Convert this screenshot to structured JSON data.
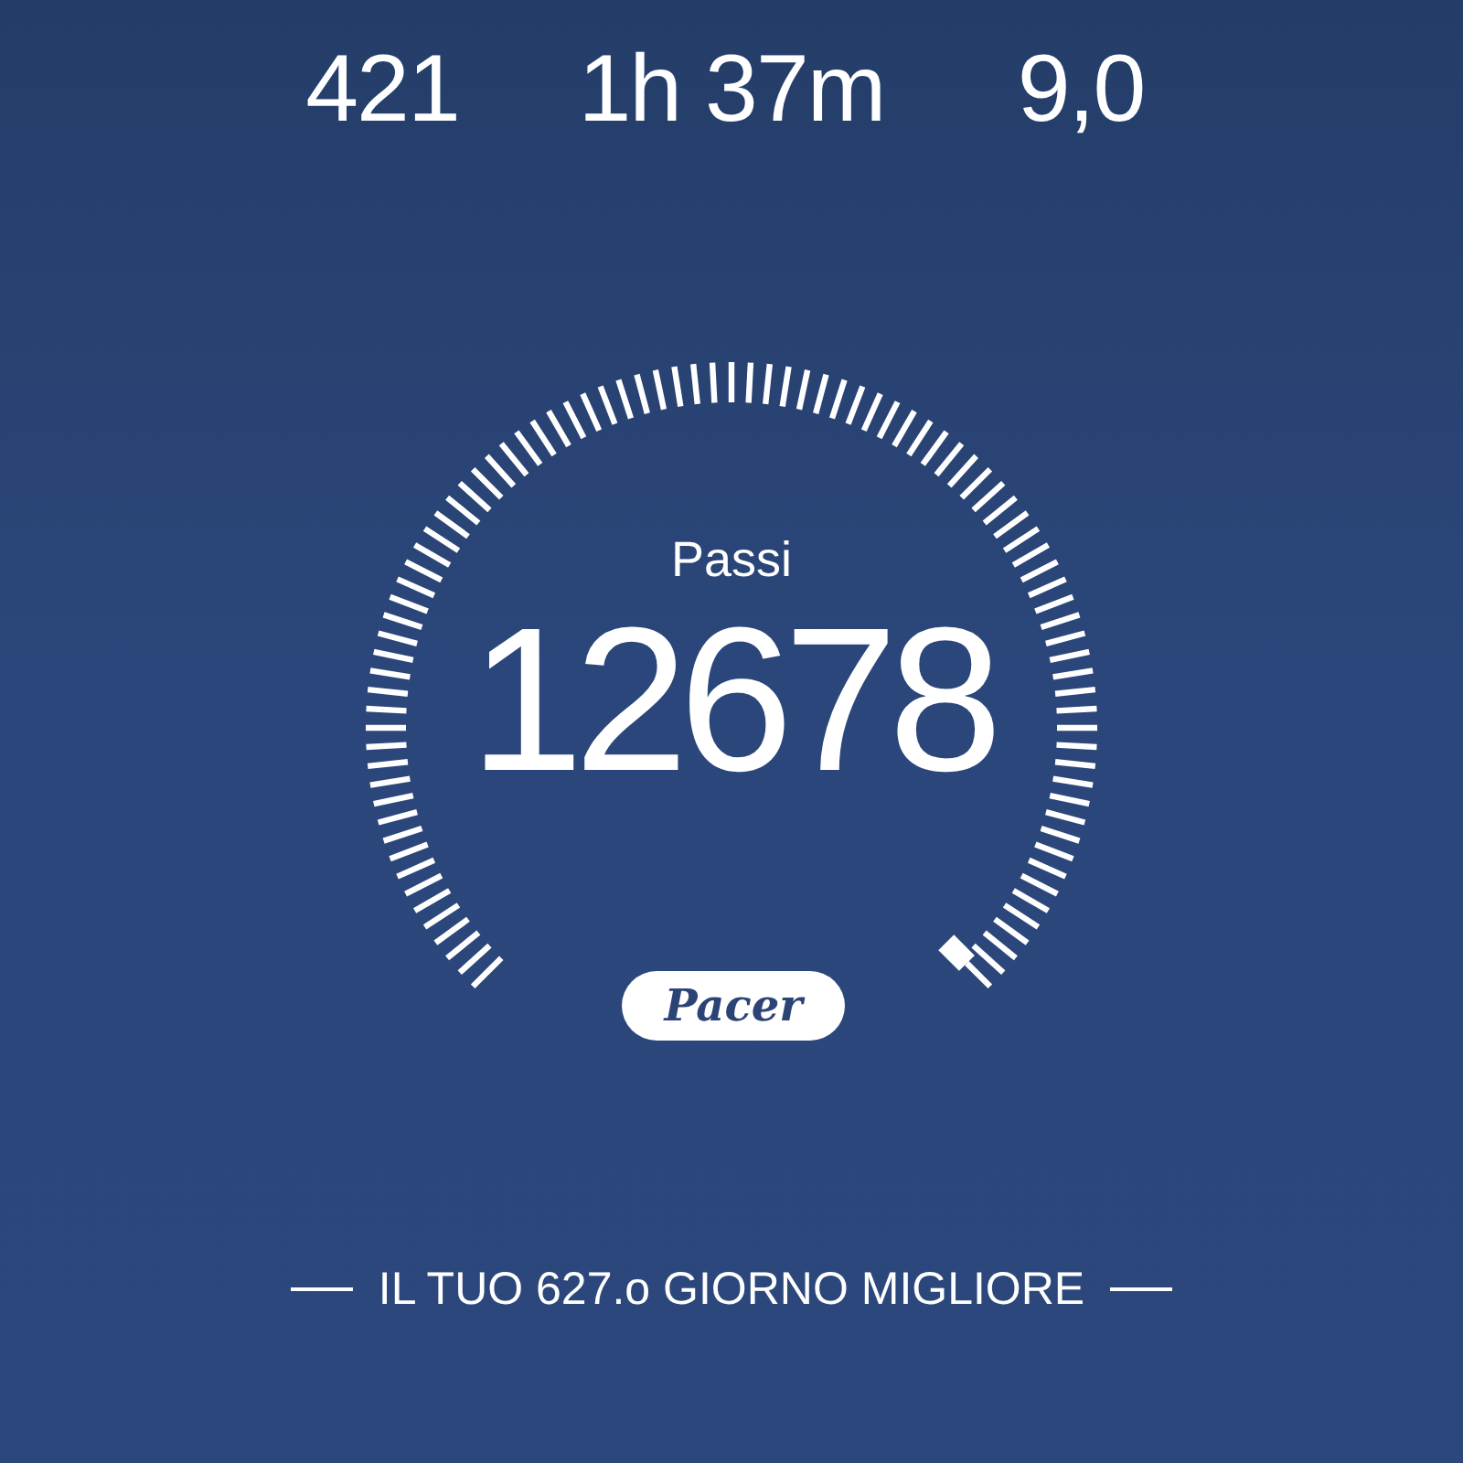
{
  "stats": [
    {
      "value": "421"
    },
    {
      "value": "1h 37m"
    },
    {
      "value": "9,0"
    }
  ],
  "gauge": {
    "label": "Passi",
    "value": "12678"
  },
  "brand": "Pacer",
  "footer": "IL TUO 627.o GIORNO MIGLIORE"
}
